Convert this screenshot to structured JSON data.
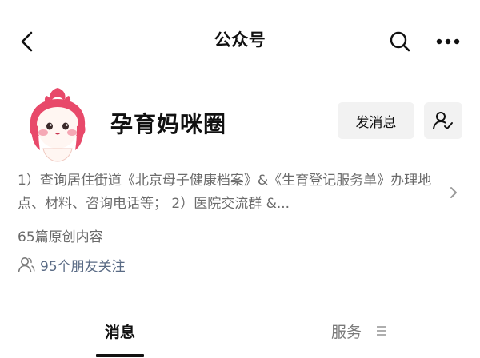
{
  "header": {
    "title": "公众号",
    "back_icon": "back-arrow-icon",
    "search_icon": "search-icon",
    "more_icon": "more-dots-icon"
  },
  "profile": {
    "avatar_icon": "strawberry-mascot-avatar",
    "name": "孕育妈咪圈",
    "message_button": "发消息",
    "follow_icon": "followed-person-check-icon",
    "description": "1）查询居住街道《北京母子健康档案》&《生育登记服务单》办理地点、材料、咨询电话等；  2）医院交流群 &...",
    "original_count": "65篇原创内容",
    "friends_following": "95个朋友关注"
  },
  "tabs": [
    {
      "label": "消息",
      "active": true
    },
    {
      "label": "服务",
      "active": false,
      "icon": "menu-lines-icon"
    }
  ],
  "colors": {
    "background": "#ffffff",
    "text_primary": "#111111",
    "text_secondary": "#6b6b6b",
    "friends_text": "#5a6b85",
    "button_bg": "#f2f2f2",
    "avatar_pink": "#e8496a"
  }
}
